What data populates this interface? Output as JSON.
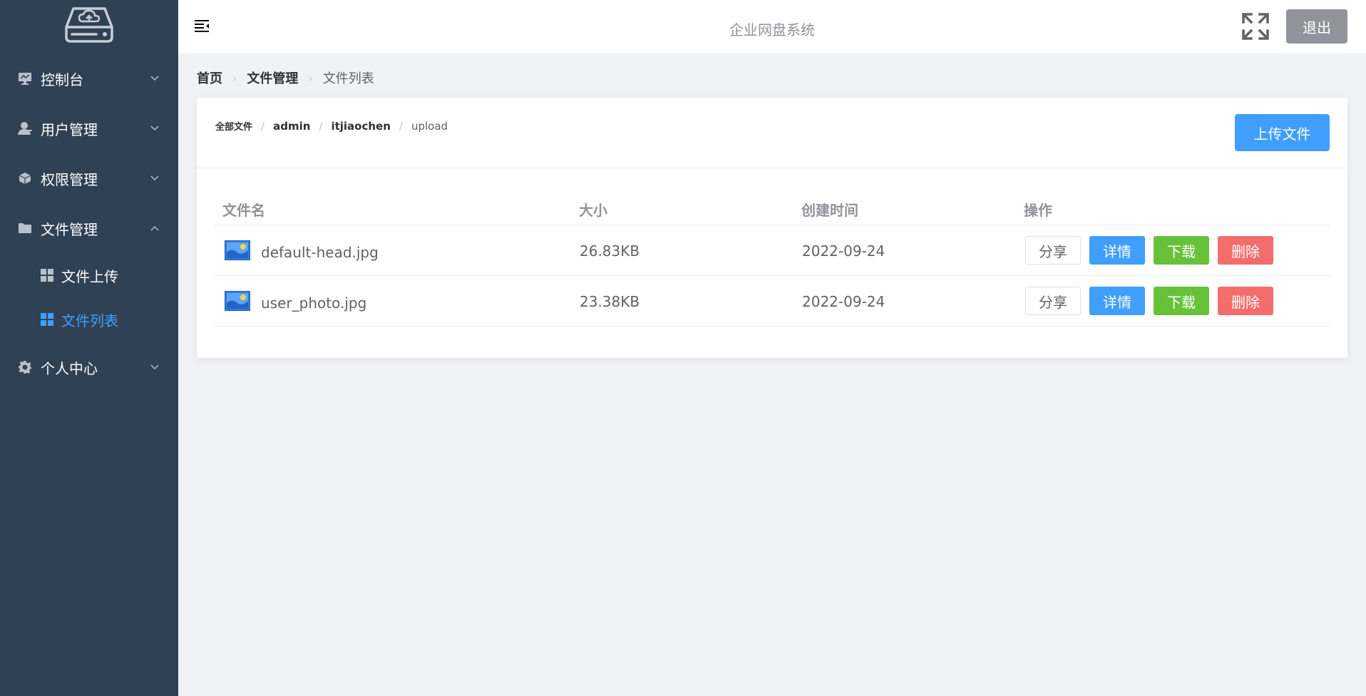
{
  "header": {
    "title": "企业网盘系统",
    "logout_label": "退出"
  },
  "sidebar": {
    "items": [
      {
        "label": "控制台",
        "icon": "monitor-icon"
      },
      {
        "label": "用户管理",
        "icon": "user-icon"
      },
      {
        "label": "权限管理",
        "icon": "cube-icon"
      },
      {
        "label": "文件管理",
        "icon": "folder-icon",
        "expanded": true
      },
      {
        "label": "个人中心",
        "icon": "gear-icon"
      }
    ],
    "subitems": [
      {
        "label": "文件上传",
        "icon": "grid-icon"
      },
      {
        "label": "文件列表",
        "icon": "grid-icon",
        "active": true
      }
    ],
    "active_color": "#409eff"
  },
  "breadcrumb": {
    "items": [
      "首页",
      "文件管理",
      "文件列表"
    ]
  },
  "path": {
    "items": [
      "全部文件",
      "admin",
      "itjiaochen",
      "upload"
    ]
  },
  "upload_label": "上传文件",
  "table": {
    "columns": [
      "文件名",
      "大小",
      "创建时间",
      "操作"
    ],
    "rows": [
      {
        "name": "default-head.jpg",
        "size": "26.83KB",
        "date": "2022-09-24"
      },
      {
        "name": "user_photo.jpg",
        "size": "23.38KB",
        "date": "2022-09-24"
      }
    ],
    "actions": {
      "share": "分享",
      "detail": "详情",
      "download": "下载",
      "delete": "删除"
    }
  }
}
